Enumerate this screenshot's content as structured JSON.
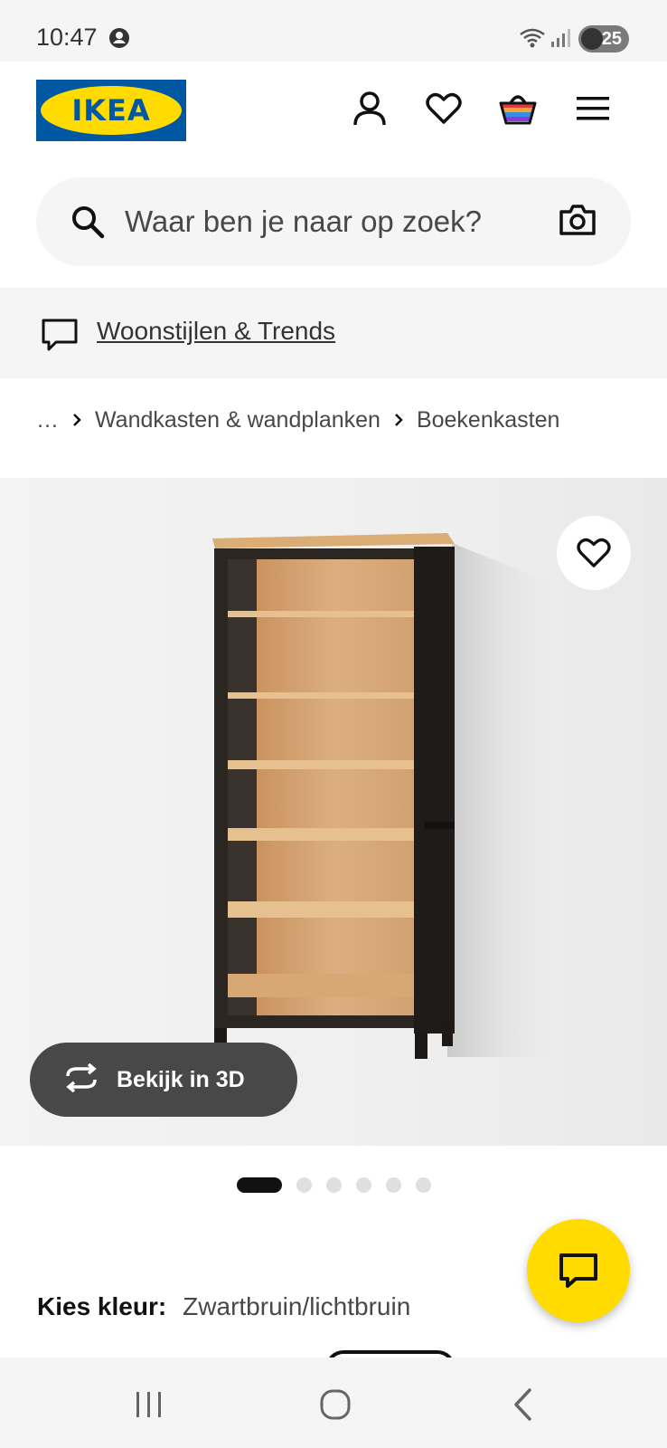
{
  "status_bar": {
    "time": "10:47",
    "battery": "25",
    "icons": [
      "account-icon",
      "wifi-icon",
      "signal-icon",
      "battery-icon"
    ]
  },
  "header": {
    "logo_text": "IKEA",
    "icons": [
      "profile-icon",
      "heart-icon",
      "basket-icon",
      "menu-icon"
    ]
  },
  "search": {
    "placeholder": "Waar ben je naar op zoek?",
    "value": "",
    "icons": [
      "search-icon",
      "camera-icon"
    ]
  },
  "promo": {
    "link_text": "Woonstijlen & Trends",
    "icon": "speech-bubble-icon"
  },
  "breadcrumb": {
    "items": [
      "…",
      "Wandkasten & wandplanken",
      "Boekenkasten"
    ]
  },
  "gallery": {
    "view_3d_label": "Bekijk in 3D",
    "image_count": 6,
    "active_index": 0,
    "icons": [
      "heart-icon",
      "rotate-3d-icon"
    ]
  },
  "chat": {
    "icon": "chat-icon"
  },
  "product": {
    "color_label": "Kies kleur:",
    "color_value": "Zwartbruin/lichtbruin"
  },
  "colors": {
    "ikea_blue": "#0058a3",
    "ikea_yellow": "#ffdb00",
    "text_dark": "#111111",
    "text_gray": "#484848",
    "surface_gray": "#f5f5f5"
  },
  "nav_bar": {
    "icons": [
      "recent-apps-icon",
      "home-icon",
      "back-icon"
    ]
  }
}
